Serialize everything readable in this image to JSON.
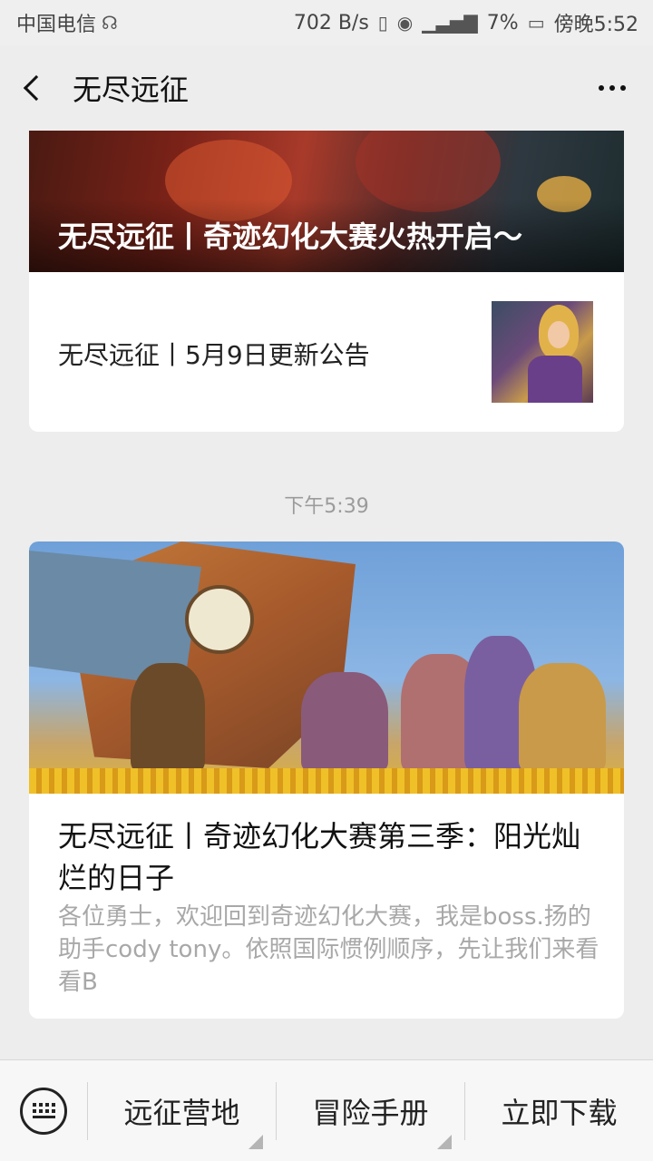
{
  "status_bar": {
    "carrier": "中国电信",
    "speed": "702 B/s",
    "battery": "7%",
    "time": "傍晚5:52"
  },
  "nav": {
    "title": "无尽远征"
  },
  "feed": {
    "card1": {
      "banner_title": "无尽远征丨奇迹幻化大赛火热开启～",
      "item_title": "无尽远征丨5月9日更新公告"
    },
    "timestamp": "下午5:39",
    "card2": {
      "title": "无尽远征丨奇迹幻化大赛第三季：阳光灿烂的日子",
      "digest": "各位勇士，欢迎回到奇迹幻化大赛，我是boss.扬的助手cody tony。依照国际惯例顺序，先让我们来看看B"
    }
  },
  "bottom_menu": {
    "items": [
      "远征营地",
      "冒险手册",
      "立即下载"
    ]
  }
}
